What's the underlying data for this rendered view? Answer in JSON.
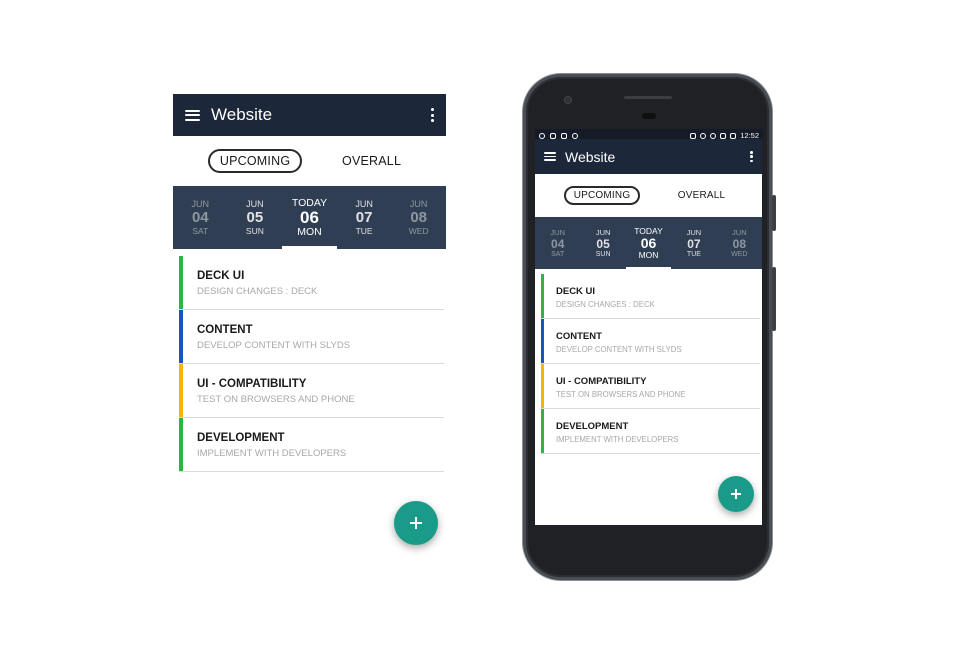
{
  "app": {
    "title": "Website",
    "tabs": [
      "UPCOMING",
      "OVERALL"
    ],
    "active_tab": "UPCOMING",
    "dates": [
      {
        "month": "JUN",
        "day": "04",
        "weekday": "SAT"
      },
      {
        "month": "JUN",
        "day": "05",
        "weekday": "SUN"
      },
      {
        "month": "TODAY",
        "day": "06",
        "weekday": "MON"
      },
      {
        "month": "JUN",
        "day": "07",
        "weekday": "TUE"
      },
      {
        "month": "JUN",
        "day": "08",
        "weekday": "WED"
      }
    ],
    "tasks": [
      {
        "title": "DECK UI",
        "subtitle": "DESIGN CHANGES : DECK",
        "color": "#2eb24a"
      },
      {
        "title": "CONTENT",
        "subtitle": "DEVELOP CONTENT WITH SLYDS",
        "color": "#1f50c9"
      },
      {
        "title": "UI - COMPATIBILITY",
        "subtitle": "TEST ON BROWSERS AND PHONE",
        "color": "#f2b705"
      },
      {
        "title": "DEVELOPMENT",
        "subtitle": "IMPLEMENT  WITH DEVELOPERS",
        "color": "#2eb24a"
      }
    ],
    "fab_icon": "plus-icon"
  },
  "phone_status": {
    "time": "12:52"
  },
  "colors": {
    "appbar": "#1c2739",
    "datestrip": "#2f3e52",
    "fab": "#1a9a88"
  }
}
